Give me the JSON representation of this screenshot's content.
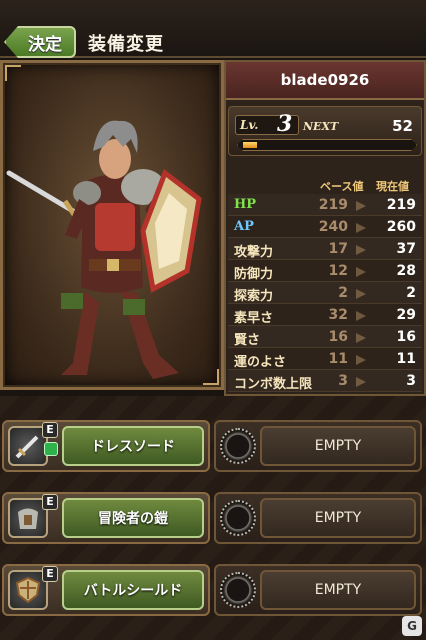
{
  "header": {
    "back_label": "決定",
    "title": "装備変更"
  },
  "character": {
    "name": "blade0926"
  },
  "level": {
    "lv_label": "Lv.",
    "lv_value": "3",
    "next_label": "NEXT",
    "next_value": "52",
    "exp_fraction": 0.08
  },
  "stats": {
    "col_base": "ベース値",
    "col_current": "現在値",
    "rows": [
      {
        "name": "HP",
        "base": "219",
        "current": "219"
      },
      {
        "name": "AP",
        "base": "240",
        "current": "260"
      },
      {
        "name": "攻撃力",
        "base": "17",
        "current": "37"
      },
      {
        "name": "防御力",
        "base": "12",
        "current": "28"
      },
      {
        "name": "探索力",
        "base": "2",
        "current": "2"
      },
      {
        "name": "素早さ",
        "base": "32",
        "current": "29"
      },
      {
        "name": "賢さ",
        "base": "16",
        "current": "16"
      },
      {
        "name": "運のよさ",
        "base": "11",
        "current": "11"
      },
      {
        "name": "コンボ数上限",
        "base": "3",
        "current": "3"
      }
    ]
  },
  "equipment": [
    {
      "badge": "E",
      "item": "ドレスソード",
      "icon": "sword-icon",
      "empty": "EMPTY"
    },
    {
      "badge": "E",
      "item": "冒険者の鎧",
      "icon": "armor-icon",
      "empty": "EMPTY"
    },
    {
      "badge": "E",
      "item": "バトルシールド",
      "icon": "shield-icon",
      "empty": "EMPTY"
    }
  ],
  "logo_text": "G",
  "colors": {
    "accent_green": "#6f8a3e",
    "hp": "#7fe34a",
    "ap": "#6ec9ff",
    "name_bar": "#6a3630"
  }
}
